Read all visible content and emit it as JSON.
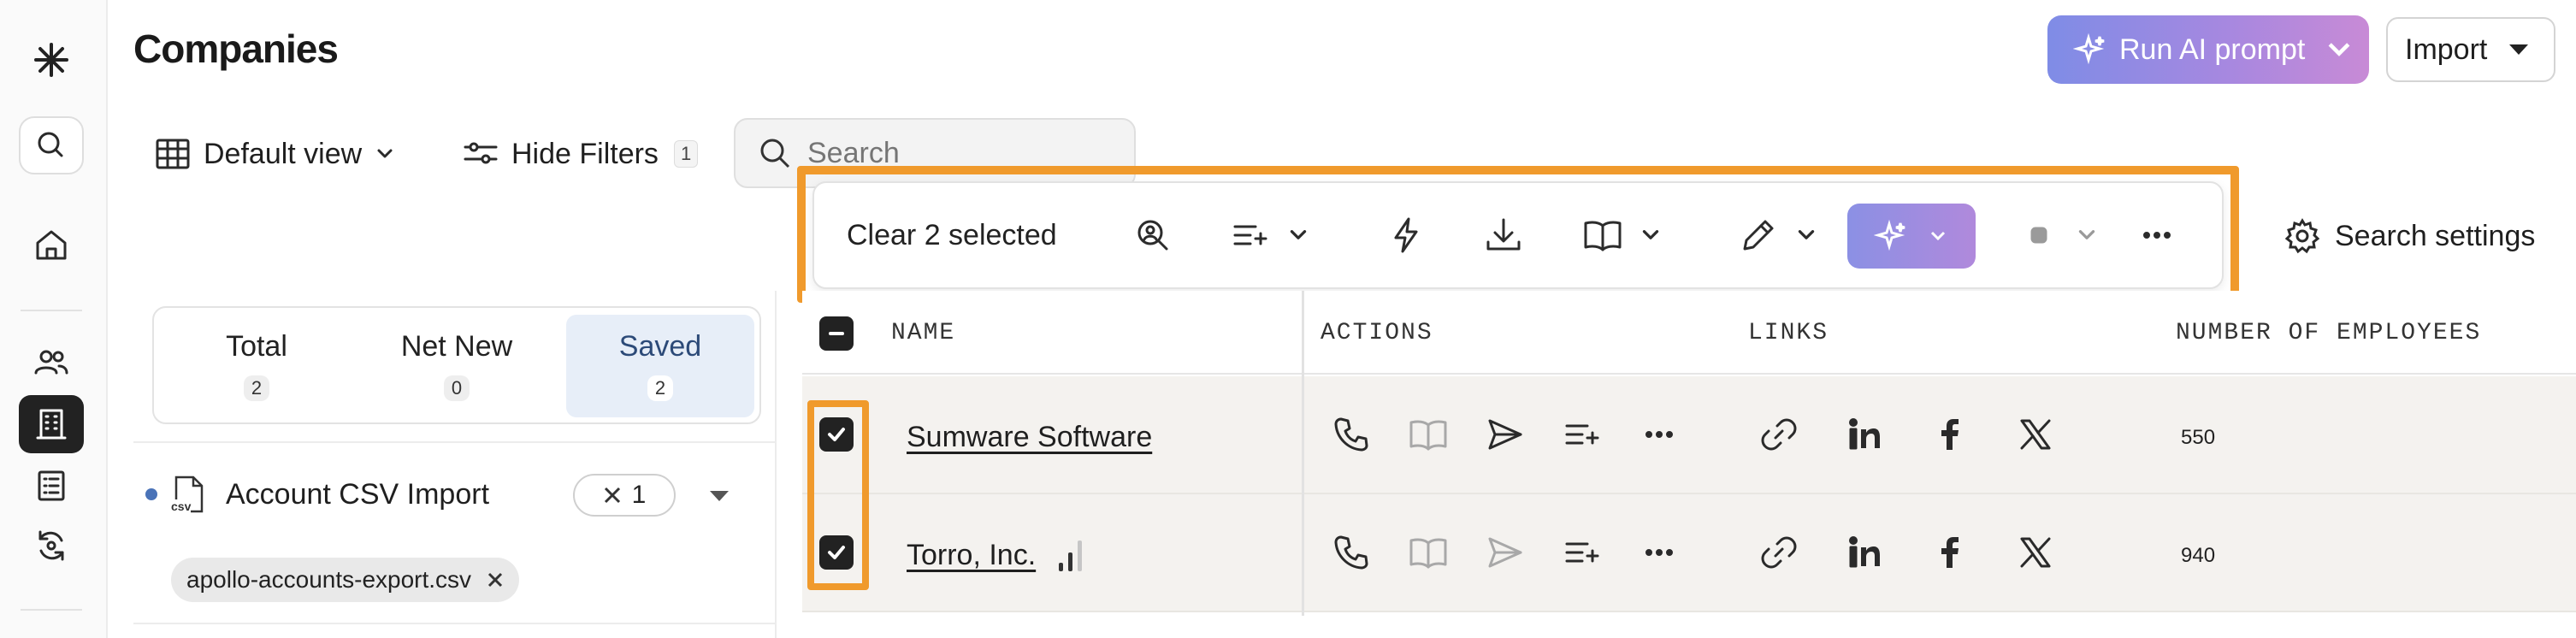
{
  "page": {
    "title": "Companies"
  },
  "header": {
    "ai_button_label": "Run AI prompt",
    "import_label": "Import"
  },
  "toolbar": {
    "view_label": "Default view",
    "filters_label": "Hide Filters",
    "filters_count": "1",
    "search_placeholder": "Search",
    "search_settings_label": "Search settings"
  },
  "selection_bar": {
    "clear_label": "Clear 2 selected"
  },
  "filter_panel": {
    "tabs": [
      {
        "label": "Total",
        "count": "2"
      },
      {
        "label": "Net New",
        "count": "0"
      },
      {
        "label": "Saved",
        "count": "2"
      }
    ],
    "active_tab": "Saved",
    "list_name": "Account CSV Import",
    "list_icon_text": "csv",
    "list_count": "1",
    "file_chip": "apollo-accounts-export.csv"
  },
  "table": {
    "columns": [
      "NAME",
      "ACTIONS",
      "LINKS",
      "NUMBER OF EMPLOYEES"
    ],
    "rows": [
      {
        "name": "Sumware Software",
        "employees": "550",
        "selected": true
      },
      {
        "name": "Torro, Inc.",
        "employees": "940",
        "selected": true
      }
    ]
  },
  "colors": {
    "highlight": "#f09a2c",
    "ai_gradient_start": "#7f8ce6",
    "ai_gradient_end": "#c88ad6",
    "active_tab_bg": "#e7eef8",
    "row_bg": "#f4f2ef"
  },
  "icons": [
    "logo-icon",
    "search-icon",
    "home-icon",
    "people-icon",
    "building-icon",
    "list-icon",
    "sync-icon",
    "table-icon",
    "filter-icon",
    "sparkle-icon",
    "gear-icon",
    "phone-icon",
    "book-icon",
    "send-icon",
    "add-to-list-icon",
    "more-icon",
    "link-icon",
    "linkedin-icon",
    "facebook-icon",
    "x-twitter-icon"
  ]
}
